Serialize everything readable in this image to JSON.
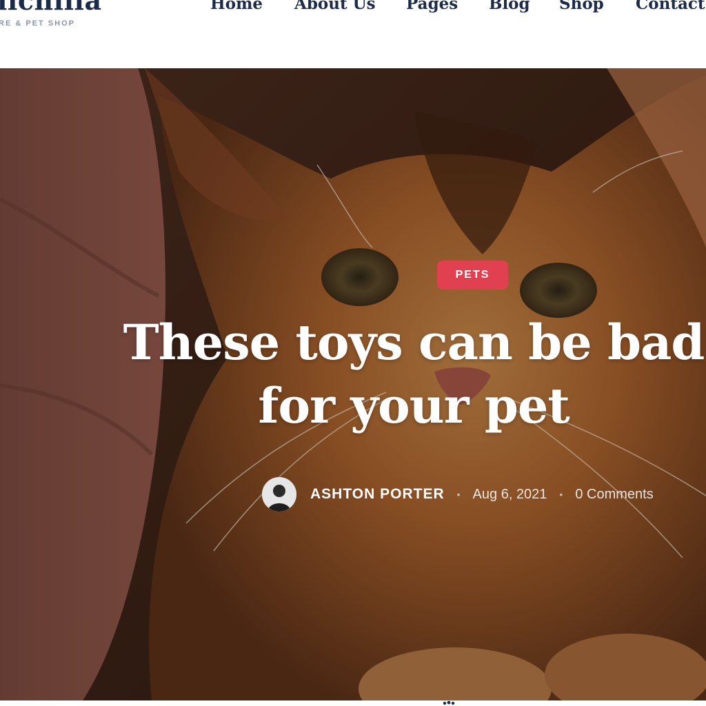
{
  "header": {
    "logo_name": "lichilia",
    "logo_tagline": "RE & PET SHOP",
    "nav": [
      "Home",
      "About Us",
      "Pages",
      "Blog",
      "Shop",
      "Contact"
    ]
  },
  "hero": {
    "category": "PETS",
    "title_line1": "These toys can be bad",
    "title_line2": "for your pet",
    "author": "ASHTON PORTER",
    "date": "Aug 6, 2021",
    "comments": "0 Comments"
  },
  "colors": {
    "nav_text": "#1c2b4a",
    "badge": "#e0404f",
    "title": "#ffffff"
  },
  "icons": {
    "author_avatar": "avatar",
    "bottom": "paw-icon"
  }
}
